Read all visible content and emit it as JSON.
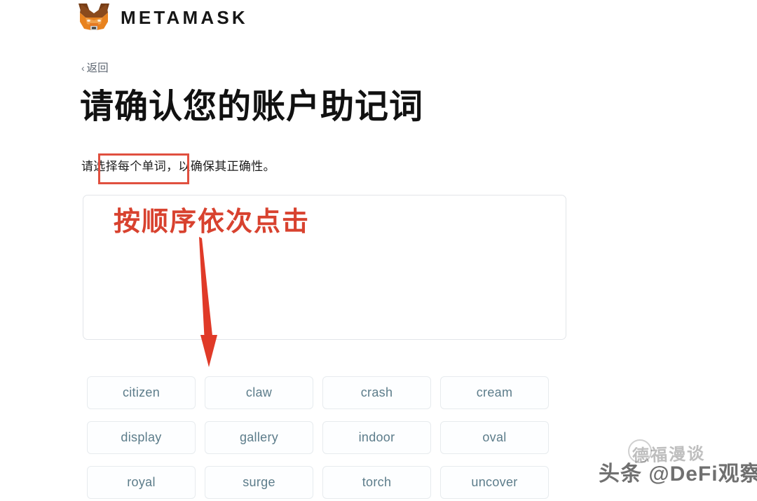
{
  "brand": {
    "logo_icon": "metamask-fox-icon",
    "wordmark": "METAMASK"
  },
  "nav": {
    "back_chevron": "‹",
    "back_label": "返回"
  },
  "content": {
    "title": "请确认您的账户助记词",
    "subtitle": "请选择每个单词，以确保其正确性。",
    "drop_zone_placeholder": ""
  },
  "annotations": {
    "highlight_box_label": "选择每个单词",
    "instruction_text": "按顺序依次点击",
    "arrow_icon": "down-arrow-icon",
    "accent_color": "#d8422f",
    "box_border_color": "#e0503f"
  },
  "word_bank": {
    "words": [
      "citizen",
      "claw",
      "crash",
      "cream",
      "display",
      "gallery",
      "indoor",
      "oval",
      "royal",
      "surge",
      "torch",
      "uncover"
    ]
  },
  "watermark": {
    "top_text": "德福漫谈",
    "main_text": "头条 @DeFi观察"
  },
  "theme": {
    "background": "#ffffff",
    "text": "#111111",
    "muted_text": "#6a737d",
    "chip_text": "#5c7c8a",
    "chip_border": "#e7ebee",
    "zone_border": "#e2e5e9"
  }
}
